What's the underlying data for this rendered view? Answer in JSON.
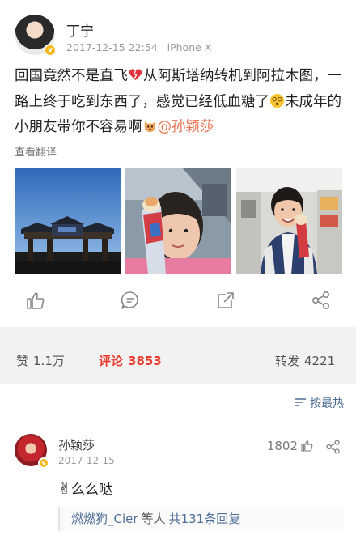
{
  "post": {
    "username": "丁宁",
    "timestamp": "2017-12-15 22:54",
    "device": "iPhone X",
    "content_part1": "回国竟然不是直飞",
    "content_part2": "从阿斯塔纳转机到阿拉木图，一路上终于吃到东西了，感觉已经低血糖了",
    "content_part3": "未成年的小朋友带你不容易啊",
    "mention": "@孙颖莎",
    "translate_label": "查看翻译",
    "images": [
      "photo-arch-gate",
      "photo-woman-selfie-icecream",
      "photo-boy-icecream"
    ],
    "verified_badge": "v"
  },
  "actions": {
    "icons": [
      "like-icon",
      "comment-icon",
      "repost-icon",
      "share-icon"
    ]
  },
  "stats": {
    "likes_label": "赞",
    "likes_count": "1.1万",
    "comments_label": "评论",
    "comments_count": "3853",
    "reposts_label": "转发",
    "reposts_count": "4221"
  },
  "comments": {
    "sort_label": "按最热",
    "items": [
      {
        "username": "孙颖莎",
        "date": "2017-12-15",
        "like_count": "1802",
        "text": "么么哒",
        "reply_users": "燃燃狗_Cier",
        "reply_mid": "等人",
        "reply_total": "共131条回复"
      }
    ]
  },
  "colors": {
    "accent_red": "#eb3b2f",
    "mention_orange": "#eb7350",
    "link_blue": "#4d6e97",
    "verified_gold": "#f6b81c"
  }
}
